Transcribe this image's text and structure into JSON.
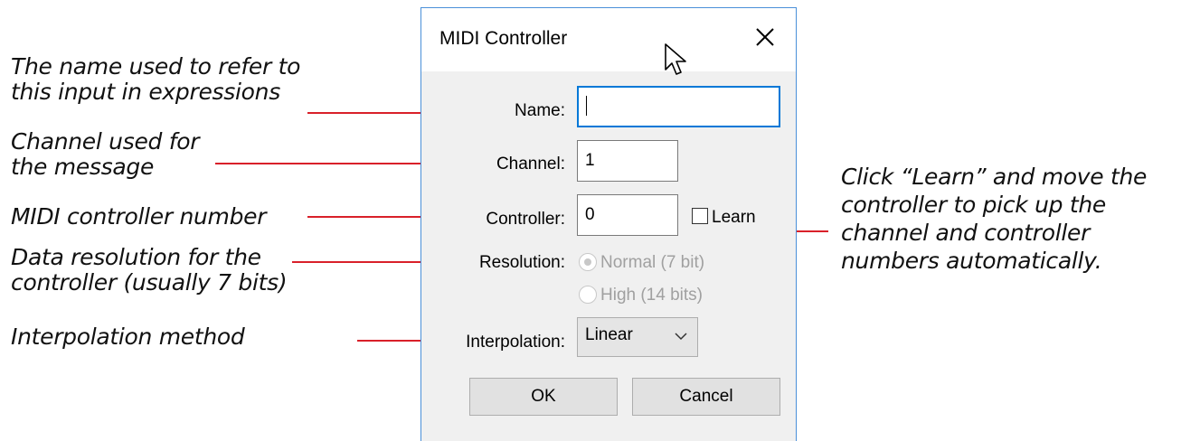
{
  "dialog": {
    "title": "MIDI Controller",
    "name": {
      "label": "Name:",
      "value": ""
    },
    "channel": {
      "label": "Channel:",
      "value": "1"
    },
    "controller": {
      "label": "Controller:",
      "value": "0",
      "learn_label": "Learn",
      "learn_checked": false
    },
    "resolution": {
      "label": "Resolution:",
      "options": [
        {
          "label": "Normal (7 bit)",
          "selected": true
        },
        {
          "label": "High (14 bits)",
          "selected": false
        }
      ],
      "disabled": true
    },
    "interpolation": {
      "label": "Interpolation:",
      "value": "Linear"
    },
    "buttons": {
      "ok": "OK",
      "cancel": "Cancel"
    }
  },
  "annotations": {
    "name": [
      "The name used to refer to",
      "this input in expressions"
    ],
    "channel": [
      "Channel used for",
      "the message"
    ],
    "controller": [
      "MIDI controller number"
    ],
    "resolution": [
      "Data resolution for the",
      "controller (usually 7 bits)"
    ],
    "interpolation": [
      "Interpolation method"
    ],
    "learn": [
      "Click “Learn” and move the",
      "controller to pick up the",
      "channel and controller",
      "numbers automatically."
    ]
  },
  "colors": {
    "leader": "#d9202a",
    "focus_border": "#0078d7",
    "window_border": "#4a90d9"
  }
}
